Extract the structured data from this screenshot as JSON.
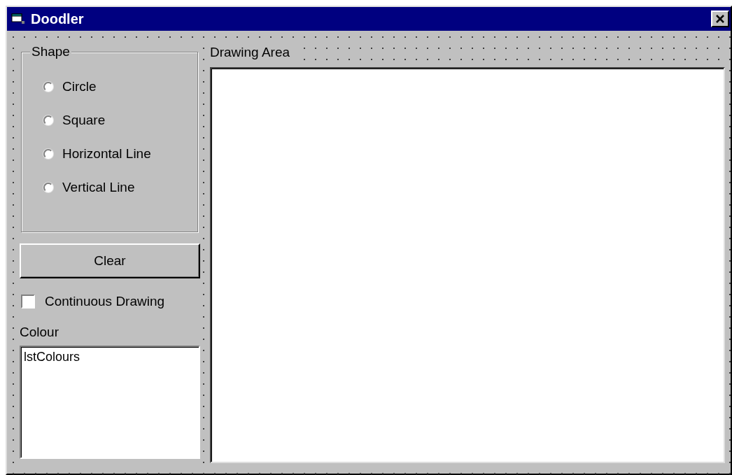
{
  "window": {
    "title": "Doodler"
  },
  "shape_frame": {
    "label": "Shape",
    "options": [
      {
        "label": "Circle",
        "selected": false
      },
      {
        "label": "Square",
        "selected": false
      },
      {
        "label": "Horizontal Line",
        "selected": false
      },
      {
        "label": "Vertical Line",
        "selected": false
      }
    ]
  },
  "clear_button": {
    "label": "Clear"
  },
  "continuous_drawing": {
    "label": "Continuous Drawing",
    "checked": false
  },
  "colour": {
    "label": "Colour",
    "list_items": [
      "lstColours"
    ]
  },
  "drawing_area": {
    "label": "Drawing Area"
  }
}
